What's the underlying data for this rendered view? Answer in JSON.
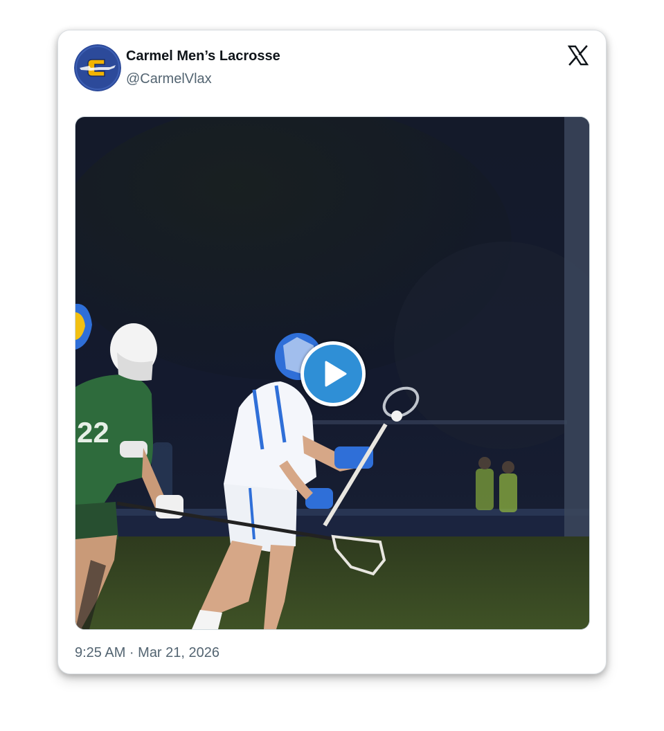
{
  "tweet": {
    "author_name": "Carmel Men’s Lacrosse",
    "author_handle": "@CarmelVlax",
    "timestamp": "9:25 AM · Mar 21, 2026",
    "media": {
      "type": "video",
      "description_icon": "play-icon"
    }
  },
  "icons": {
    "platform": "x-logo-icon",
    "avatar": "carmel-c-logo-icon",
    "play": "play-icon"
  },
  "colors": {
    "avatar_bg": "#2c4a9a",
    "avatar_letter": "#f2b400",
    "play_button": "#2f8fd6",
    "name_text": "#0f1419",
    "meta_text": "#536471",
    "home_jersey": "#ffffff",
    "away_jersey": "#2e6b3c",
    "helmet_blue": "#2f6fd8"
  }
}
